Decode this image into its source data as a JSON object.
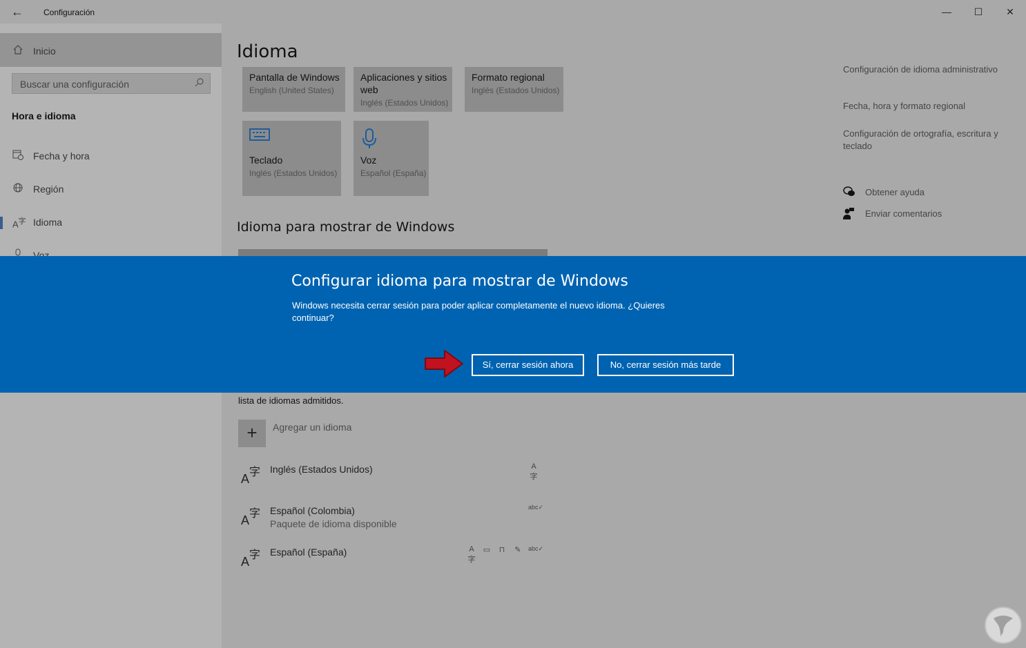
{
  "window": {
    "app_title": "Configuración",
    "back_icon": "arrow-left-icon",
    "controls": {
      "minimize": "—",
      "maximize": "☐",
      "close": "✕"
    }
  },
  "sidebar": {
    "home_label": "Inicio",
    "search_placeholder": "Buscar una configuración",
    "section_title": "Hora e idioma",
    "items": [
      {
        "label": "Fecha y hora",
        "icon": "calendar-clock-icon"
      },
      {
        "label": "Región",
        "icon": "globe-icon"
      },
      {
        "label": "Idioma",
        "icon": "language-icon",
        "selected": true
      },
      {
        "label": "Voz",
        "icon": "microphone-icon"
      }
    ]
  },
  "main": {
    "page_title": "Idioma",
    "tiles": [
      {
        "title": "Pantalla de Windows",
        "subtitle": "English (United States)"
      },
      {
        "title": "Aplicaciones y sitios web",
        "subtitle": "Inglés (Estados Unidos)"
      },
      {
        "title": "Formato regional",
        "subtitle": "Inglés (Estados Unidos)"
      },
      {
        "title": "Teclado",
        "subtitle": "Inglés (Estados Unidos)",
        "icon": "keyboard-icon"
      },
      {
        "title": "Voz",
        "subtitle": "Español (España)",
        "icon": "microphone-icon"
      }
    ],
    "display_heading": "Idioma para mostrar de Windows",
    "languages_desc": "lista de idiomas admitidos.",
    "add_language_label": "Agregar un idioma",
    "languages": [
      {
        "name": "Inglés (Estados Unidos)",
        "subtitle": ""
      },
      {
        "name": "Español (Colombia)",
        "subtitle": "Paquete de idioma disponible"
      },
      {
        "name": "Español (España)",
        "subtitle": ""
      }
    ]
  },
  "related": {
    "admin_settings": "Configuración de idioma administrativo",
    "date_time_format": "Fecha, hora y formato regional",
    "spelling_settings": "Configuración de ortografía, escritura y teclado",
    "get_help": "Obtener ayuda",
    "send_feedback": "Enviar comentarios"
  },
  "dialog": {
    "title": "Configurar idioma para mostrar de Windows",
    "message": "Windows necesita cerrar sesión para poder aplicar completamente el nuevo idioma. ¿Quieres continuar?",
    "yes_label": "Sí, cerrar sesión ahora",
    "no_label": "No, cerrar sesión más tarde",
    "background_color": "#0063b1",
    "arrow_color": "#c0121f"
  }
}
